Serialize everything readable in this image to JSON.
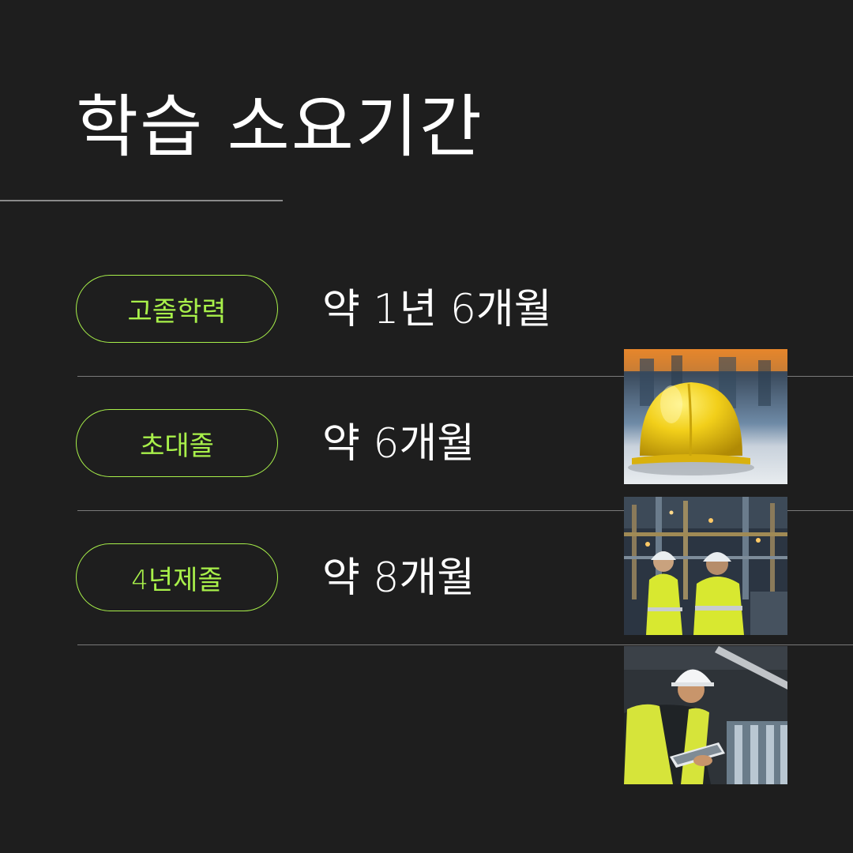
{
  "title": "학습 소요기간",
  "rows": [
    {
      "badge": "고졸학력",
      "duration": "약 1년 6개월"
    },
    {
      "badge": "초대졸",
      "duration": "약 6개월"
    },
    {
      "badge": "4년제졸",
      "duration": "약 8개월"
    }
  ],
  "colors": {
    "background": "#1e1e1e",
    "accent": "#a8f04a",
    "text": "#ffffff",
    "divider": "#7a7a7a"
  },
  "images": [
    {
      "name": "yellow-hard-hat-photo"
    },
    {
      "name": "industrial-workers-photo"
    },
    {
      "name": "engineer-with-tablet-photo"
    }
  ]
}
